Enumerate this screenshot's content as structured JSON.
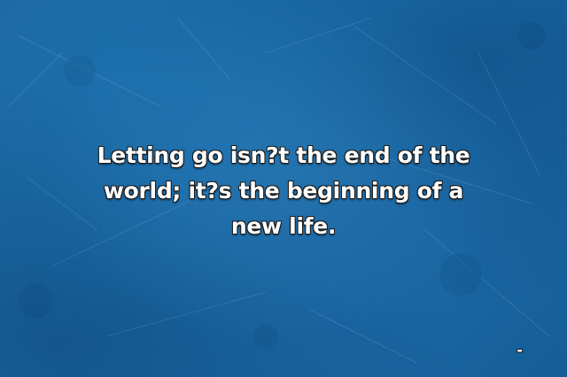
{
  "quote": {
    "text": "Letting go isn?t the end of the world; it?s the beginning of a new life.",
    "attribution": "-"
  },
  "colors": {
    "background": "#1b6fae",
    "text": "#ffffff",
    "outline": "#1a1a1a"
  }
}
